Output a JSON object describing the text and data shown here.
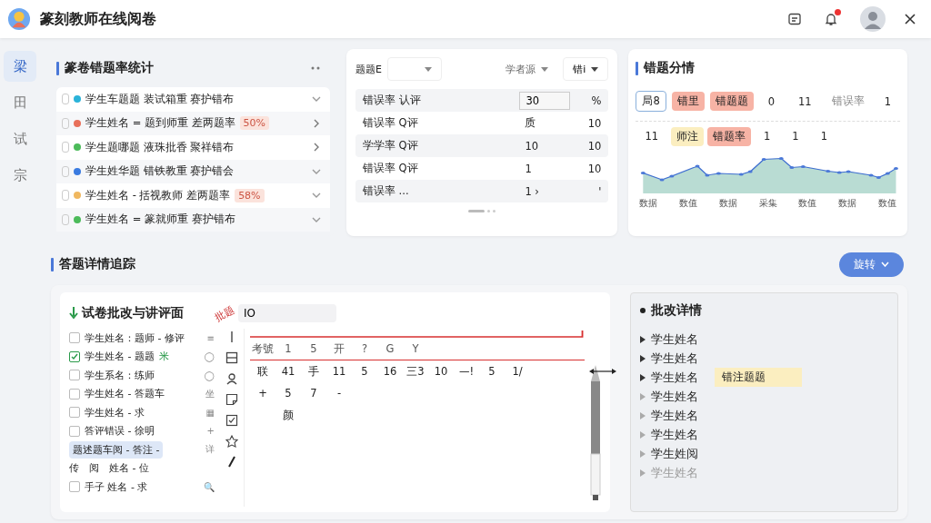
{
  "app": {
    "title": "篆刻教师在线阅卷",
    "notification": true
  },
  "sidebar": [
    {
      "label": "梁",
      "selected": true
    },
    {
      "label": "田",
      "selected": false
    },
    {
      "label": "试",
      "selected": false
    },
    {
      "label": "宗",
      "selected": false
    }
  ],
  "error_stats": {
    "title": "篆卷错题率统计",
    "items": [
      {
        "text": "学生车题题 装试箱重 赛护错布",
        "color": "#2bb3d9",
        "checked": false,
        "expanded": true
      },
      {
        "text": "学生姓名 = 题到师重 差两题率",
        "color": "#e8705a",
        "checked": false,
        "badge": "50%",
        "expanded": false
      },
      {
        "text": "学生题哪题 液珠批香 聚祥错布",
        "color": "#4cbb5a",
        "checked": false,
        "expanded": false
      },
      {
        "text": "学生姓华题 错铁教重 赛护错会",
        "color": "#3a7be0",
        "checked": false,
        "expanded": true
      },
      {
        "text": "学生姓名 - 括视教师 差两题率",
        "color": "#f0b860",
        "checked": false,
        "badge": "58%",
        "expanded": true
      },
      {
        "text": "学生姓名 = 篆就师重 赛护错布",
        "color": "#4cbb5a",
        "checked": false,
        "expanded": true
      }
    ]
  },
  "filter_table": {
    "filters": [
      {
        "label": "题题E"
      },
      {
        "value": "学者源"
      },
      {
        "value": "错i"
      }
    ],
    "rows": [
      {
        "name": "错误率 认评",
        "kind": "input",
        "value": "30",
        "extra": "%"
      },
      {
        "name": "错误率 Q评",
        "kind": "box",
        "value": "质",
        "extra": "10"
      },
      {
        "name": "学学率 Q评",
        "kind": "plain",
        "value": "10",
        "extra": "10"
      },
      {
        "name": "错误率 Q评",
        "kind": "plain",
        "value": "1",
        "extra": "10"
      },
      {
        "name": "错误率 ...",
        "kind": "plain",
        "value": "1 ›",
        "extra": "'"
      }
    ],
    "pages": [
      {
        "selected": true
      },
      {
        "selected": false
      },
      {
        "selected": false
      }
    ]
  },
  "error_chart": {
    "title": "错题分情",
    "tags": [
      {
        "text": "局8",
        "kind": "outline"
      },
      {
        "text": "错里",
        "kind": "red"
      },
      {
        "text": "错题题",
        "kind": "red"
      },
      {
        "text": "0",
        "kind": "plain"
      },
      {
        "text": "11",
        "kind": "plain"
      },
      {
        "text": "错误率",
        "kind": "muted"
      },
      {
        "text": "1",
        "kind": "plain"
      }
    ],
    "overlay": [
      {
        "text": "11",
        "kind": "plain"
      },
      {
        "text": "师注",
        "kind": "yellow"
      },
      {
        "text": "错题率",
        "kind": "red"
      },
      {
        "text": "1",
        "kind": "plain"
      },
      {
        "text": "1",
        "kind": "plain"
      },
      {
        "text": "1",
        "kind": "plain"
      }
    ],
    "labels": [
      "数据",
      "数值",
      "数据",
      "采集",
      "数值",
      "数据",
      "数值"
    ]
  },
  "details_section": {
    "title": "答题详情追踪",
    "button": "旋转"
  },
  "workspace": {
    "title": "试卷批改与讲评面",
    "search": "IO",
    "annotation": "批题",
    "items": [
      {
        "text": "学生姓名：题师 - 修评",
        "checked": false,
        "side": "≡"
      },
      {
        "text": "学生姓名 - 题题",
        "checked": true,
        "side": "◯",
        "mark": "米"
      },
      {
        "text": "学生系名：练师",
        "checked": false,
        "side": "◯"
      },
      {
        "text": "学生姓名 - 答题车",
        "checked": false,
        "side": "坐"
      },
      {
        "text": "学生姓名 - 求",
        "checked": false,
        "side": "▦"
      },
      {
        "text": "答评错误 - 徐明",
        "checked": false,
        "side": "+"
      },
      {
        "text": "题述题车阅 - 答注 -",
        "kind": "chip",
        "selected": true,
        "side": "详"
      },
      {
        "text": "传　阅　姓名 - 位",
        "kind": "plain",
        "selected": false
      },
      {
        "text": "手子 姓名 - 求",
        "checked": false,
        "side": "🔍"
      }
    ],
    "tools": [
      {
        "kind": "cursor"
      },
      {
        "kind": "calendar"
      },
      {
        "kind": "person"
      },
      {
        "kind": "note"
      },
      {
        "kind": "check"
      },
      {
        "kind": "star"
      },
      {
        "kind": "pen"
      }
    ],
    "grid": [
      {
        "kind": "head",
        "cells": [
          "考號",
          "1",
          "5",
          "开",
          "?",
          "G",
          "Y"
        ]
      },
      {
        "kind": "body",
        "cells": [
          "联",
          "41",
          "手",
          "11",
          "5",
          "16",
          "三3",
          "10",
          "—!",
          "5",
          "1/"
        ]
      },
      {
        "kind": "body",
        "cells": [
          "+",
          "5",
          "7",
          "-"
        ]
      },
      {
        "kind": "note",
        "cells": [
          "颜"
        ]
      }
    ]
  },
  "review": {
    "title": "批改详情",
    "items": [
      {
        "text": "学生姓名",
        "active": true,
        "disabled": false
      },
      {
        "text": "学生姓名",
        "active": true,
        "disabled": false
      },
      {
        "text": "学生姓名",
        "active": true,
        "disabled": false,
        "tag": "错注题题"
      },
      {
        "text": "学生姓名",
        "active": false,
        "disabled": false
      },
      {
        "text": "学生姓名",
        "active": false,
        "disabled": false
      },
      {
        "text": "学生姓名",
        "active": false,
        "disabled": false
      },
      {
        "text": "学生姓阅",
        "active": false,
        "disabled": false
      },
      {
        "text": "学生姓名",
        "active": false,
        "disabled": true
      }
    ]
  }
}
